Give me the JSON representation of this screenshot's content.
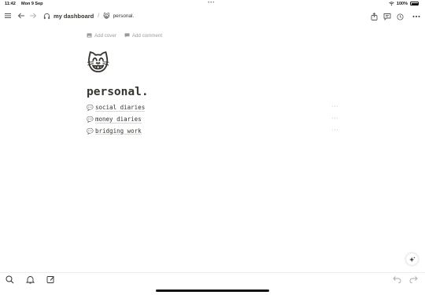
{
  "status_bar": {
    "time": "11:42",
    "date": "Mon 9 Sep",
    "battery": "100%"
  },
  "nav": {
    "workspace_label": "my dashboard",
    "workspace_icon": "headphones-icon",
    "separator": "/",
    "page_emoji": "😸",
    "page_label": "personal."
  },
  "page": {
    "add_cover_label": "Add cover",
    "add_comment_label": "Add comment",
    "icon": "😸",
    "title": "personal.",
    "subpages": [
      {
        "icon": "💬",
        "label": "social diaries",
        "more": "···"
      },
      {
        "icon": "💬",
        "label": "money diaries",
        "more": "···"
      },
      {
        "icon": "💬",
        "label": "bridging work",
        "more": "···"
      }
    ]
  },
  "colors": {
    "text": "#37352f",
    "muted": "#9b9a97",
    "icon": "#5a5a5a"
  }
}
